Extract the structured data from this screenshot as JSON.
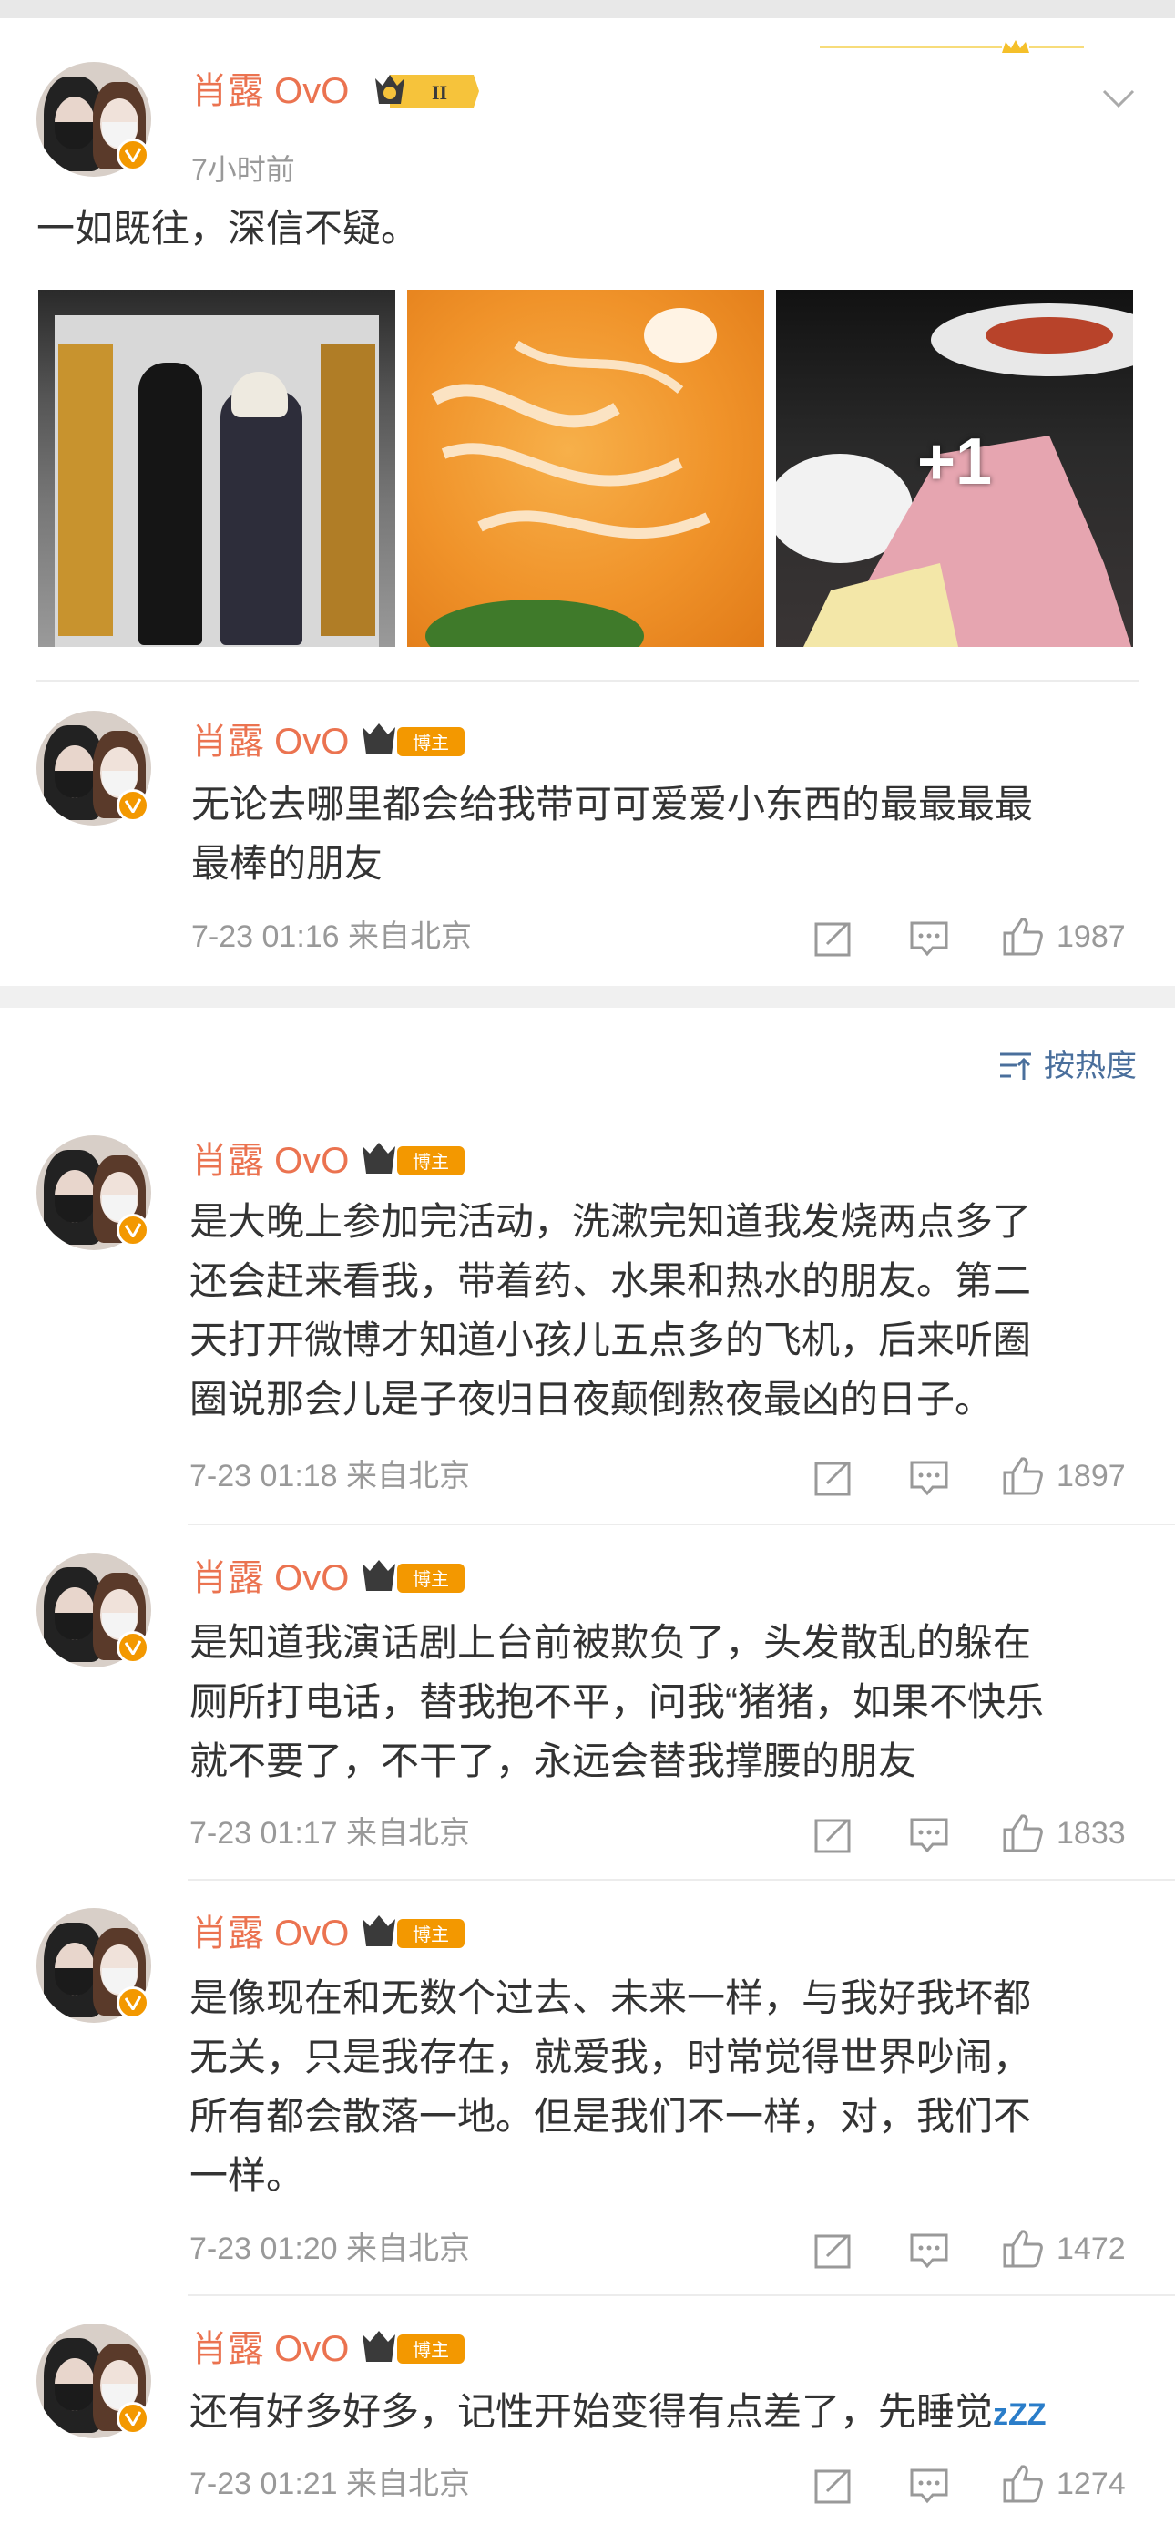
{
  "post": {
    "author": "肖露 OvO",
    "time": "7小时前",
    "level_badge": "II",
    "text": "一如既往，深信不疑。",
    "more_photos": "+1"
  },
  "pinned_reply": {
    "author": "肖露 OvO",
    "badge": "博主",
    "text_line1": "无论去哪里都会给我带可可爱爱小东西的最最最最",
    "text_line2": "最棒的朋友",
    "meta": "7-23 01:16  来自北京",
    "likes": "1987"
  },
  "comments": {
    "sort_label": "按热度",
    "items": [
      {
        "author": "肖露 OvO",
        "badge": "博主",
        "lines": [
          "是大晚上参加完活动，洗漱完知道我发烧两点多了",
          "还会赶来看我，带着药、水果和热水的朋友。第二",
          "天打开微博才知道小孩儿五点多的飞机，后来听圈",
          "圈说那会儿是子夜归日夜颠倒熬夜最凶的日子。"
        ],
        "meta": "7-23 01:18  来自北京",
        "likes": "1897"
      },
      {
        "author": "肖露 OvO",
        "badge": "博主",
        "lines": [
          "是知道我演话剧上台前被欺负了，头发散乱的躲在",
          "厕所打电话，替我抱不平，问我“猪猪，如果不快乐",
          "就不要了，不干了，永远会替我撑腰的朋友"
        ],
        "meta": "7-23 01:17  来自北京",
        "likes": "1833"
      },
      {
        "author": "肖露 OvO",
        "badge": "博主",
        "lines": [
          "是像现在和无数个过去、未来一样，与我好我坏都",
          "无关，只是我存在，就爱我，时常觉得世界吵闹，",
          "所有都会散落一地。但是我们不一样，对，我们不",
          "一样。"
        ],
        "meta": "7-23 01:20  来自北京",
        "likes": "1472"
      },
      {
        "author": "肖露 OvO",
        "badge": "博主",
        "lines": [
          "还有好多好多，记性开始变得有点差了，先睡觉"
        ],
        "emoji": "zZZ",
        "meta": "7-23 01:21  来自北京",
        "likes": "1274"
      }
    ]
  },
  "colors": {
    "name": "#eb7350",
    "badge": "#f39800",
    "sort": "#4a6f9c",
    "meta": "#999999"
  }
}
